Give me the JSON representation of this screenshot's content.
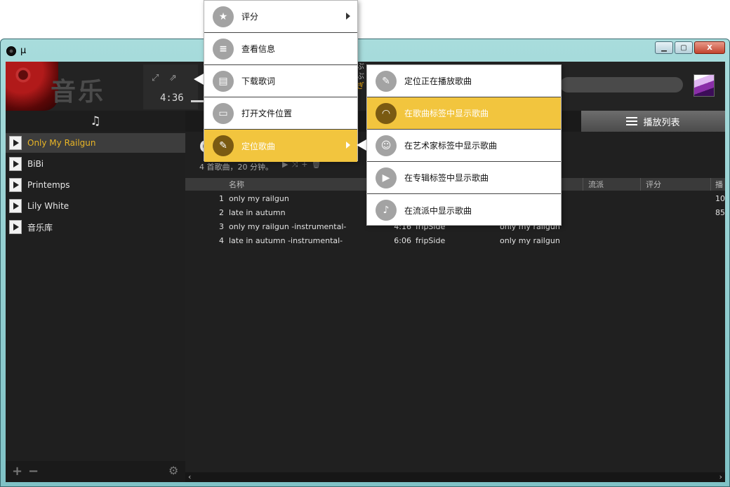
{
  "window": {
    "title": "μ",
    "controls": {
      "minimize": "▁",
      "maximize": "▢",
      "close": "X"
    }
  },
  "header": {
    "section_title": "音乐",
    "time": "4:36",
    "lyric_line1": "ぶ",
    "lyric_line2": "ぶ",
    "lyric_line3": "ぎ",
    "icons": [
      "expand-icon",
      "popout-icon",
      "search-icon",
      "user-avatar"
    ]
  },
  "tabs": {
    "music_icon": "♫",
    "playlist_label": "播放列表"
  },
  "sidebar": {
    "items": [
      {
        "label": "Only My Railgun",
        "active": true
      },
      {
        "label": "BiBi",
        "active": false
      },
      {
        "label": "Printemps",
        "active": false
      },
      {
        "label": "Lily White",
        "active": false
      },
      {
        "label": "音乐库",
        "active": false
      }
    ],
    "footer": {
      "add": "+",
      "remove": "−",
      "settings": "⚙"
    }
  },
  "main": {
    "title": "O",
    "summary": "4 首歌曲，20 分钟。",
    "actions": "▶⤨+🗑",
    "columns": {
      "name": "名称",
      "genre": "流派",
      "rating": "评分",
      "play": "播"
    },
    "rows": [
      {
        "num": "1",
        "title": "only my railgun",
        "duration": "",
        "artist": "",
        "album": "",
        "play_count": "10"
      },
      {
        "num": "2",
        "title": "late in autumn",
        "duration": "",
        "artist": "",
        "album": "",
        "play_count": "85"
      },
      {
        "num": "3",
        "title": "only my railgun -instrumental-",
        "duration": "4:16",
        "artist": "fripSide",
        "album": "only my railgun",
        "play_count": ""
      },
      {
        "num": "4",
        "title": "late in autumn -instrumental-",
        "duration": "6:06",
        "artist": "fripSide",
        "album": "only my railgun",
        "play_count": ""
      }
    ],
    "scroll": {
      "left": "‹",
      "right": "›"
    }
  },
  "context_menu": {
    "items": [
      {
        "label": "评分",
        "icon": "star-icon",
        "glyph": "★",
        "has_submenu": true,
        "active": false
      },
      {
        "label": "查看信息",
        "icon": "info-icon",
        "glyph": "≡",
        "has_submenu": false,
        "active": false
      },
      {
        "label": "下载歌词",
        "icon": "lyrics-icon",
        "glyph": "▤",
        "has_submenu": false,
        "active": false
      },
      {
        "label": "打开文件位置",
        "icon": "folder-icon",
        "glyph": "▭",
        "has_submenu": false,
        "active": false
      },
      {
        "label": "定位歌曲",
        "icon": "pin-icon",
        "glyph": "✎",
        "has_submenu": true,
        "active": true
      }
    ]
  },
  "submenu": {
    "items": [
      {
        "label": "定位正在播放歌曲",
        "icon": "pin-icon",
        "glyph": "✎",
        "active": false
      },
      {
        "label": "在歌曲标签中显示歌曲",
        "icon": "headphones-icon",
        "glyph": "◠",
        "active": true
      },
      {
        "label": "在艺术家标签中显示歌曲",
        "icon": "artist-icon",
        "glyph": "☺",
        "active": false
      },
      {
        "label": "在专辑标签中显示歌曲",
        "icon": "album-play-icon",
        "glyph": "▶",
        "active": false
      },
      {
        "label": "在流派中显示歌曲",
        "icon": "guitar-icon",
        "glyph": "♪",
        "active": false
      }
    ]
  },
  "colors": {
    "accent": "#f2c53e",
    "active_sidebar_text": "#e9b526",
    "background": "#1b1b1b"
  }
}
